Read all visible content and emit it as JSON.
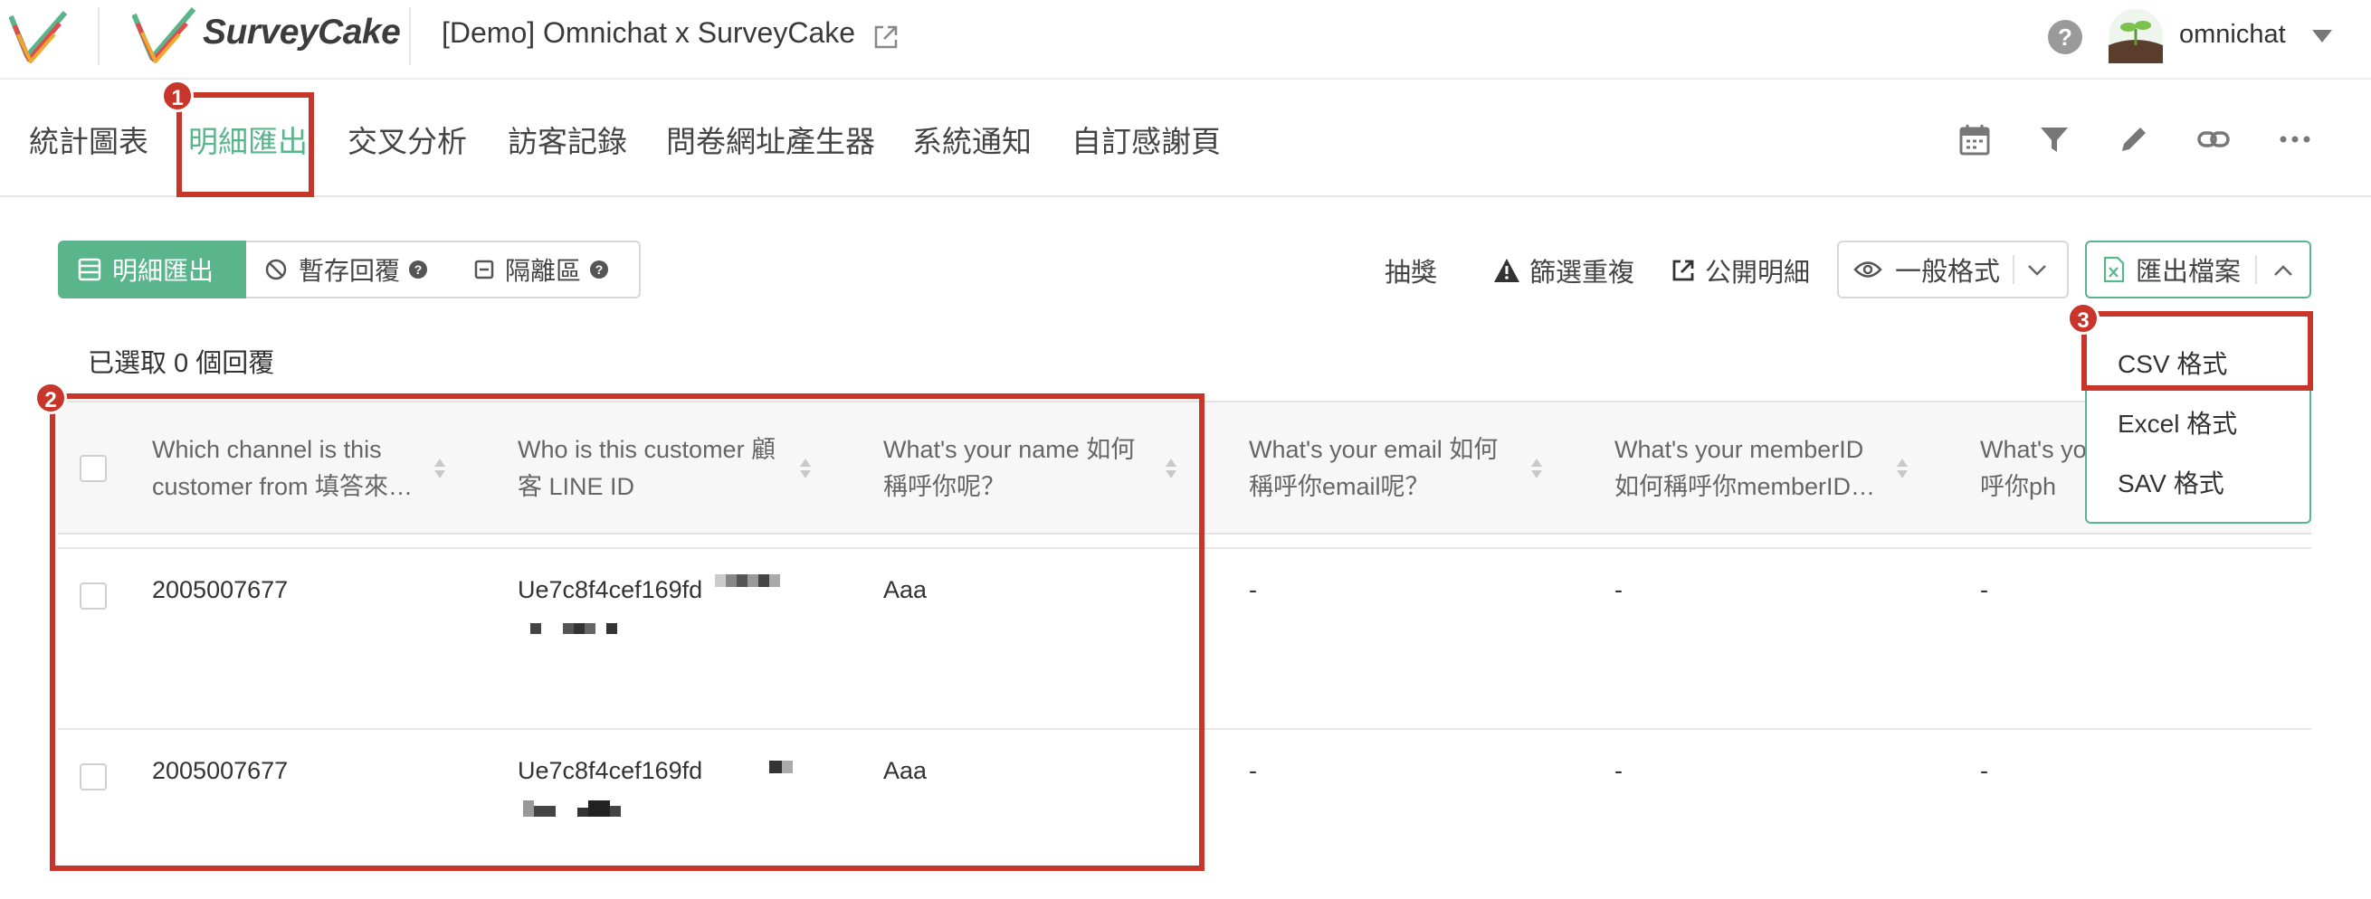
{
  "header": {
    "brand": "SurveyCake",
    "survey_title": "[Demo] Omnichat x SurveyCake",
    "username": "omnichat"
  },
  "tabs": [
    {
      "label": "統計圖表"
    },
    {
      "label": "明細匯出"
    },
    {
      "label": "交叉分析"
    },
    {
      "label": "訪客記錄"
    },
    {
      "label": "問卷網址產生器"
    },
    {
      "label": "系統通知"
    },
    {
      "label": "自訂感謝頁"
    }
  ],
  "toolbar": {
    "segments": [
      {
        "label": "明細匯出"
      },
      {
        "label": "暫存回覆"
      },
      {
        "label": "隔離區"
      }
    ],
    "lottery": "抽獎",
    "filter_duplicates": "篩選重複",
    "public_details": "公開明細",
    "view_format": "一般格式",
    "export_file": "匯出檔案"
  },
  "selected_count": "已選取 0 個回覆",
  "table": {
    "columns": [
      {
        "label": "Which channel is this customer from 填答來…"
      },
      {
        "label": "Who is this customer 顧客 LINE ID"
      },
      {
        "label": "What's your name 如何稱呼你呢？"
      },
      {
        "label": "What's your email 如何稱呼你email呢？"
      },
      {
        "label": "What's your memberID 如何稱呼你memberID…"
      },
      {
        "label": "What's yo 稱呼你ph"
      }
    ],
    "rows": [
      {
        "cells": [
          "2005007677",
          "Ue7c8f4cef169fd",
          "Aaa",
          "-",
          "-",
          "-"
        ]
      },
      {
        "cells": [
          "2005007677",
          "Ue7c8f4cef169fd",
          "Aaa",
          "-",
          "-",
          "-"
        ]
      }
    ]
  },
  "export_menu": {
    "items": [
      {
        "label": "CSV 格式"
      },
      {
        "label": "Excel 格式"
      },
      {
        "label": "SAV 格式"
      }
    ]
  },
  "annotations": {
    "badges": [
      "1",
      "2",
      "3"
    ],
    "color": "#c8352a"
  },
  "colors": {
    "accent": "#5bb58c",
    "annotation": "#c8352a"
  }
}
